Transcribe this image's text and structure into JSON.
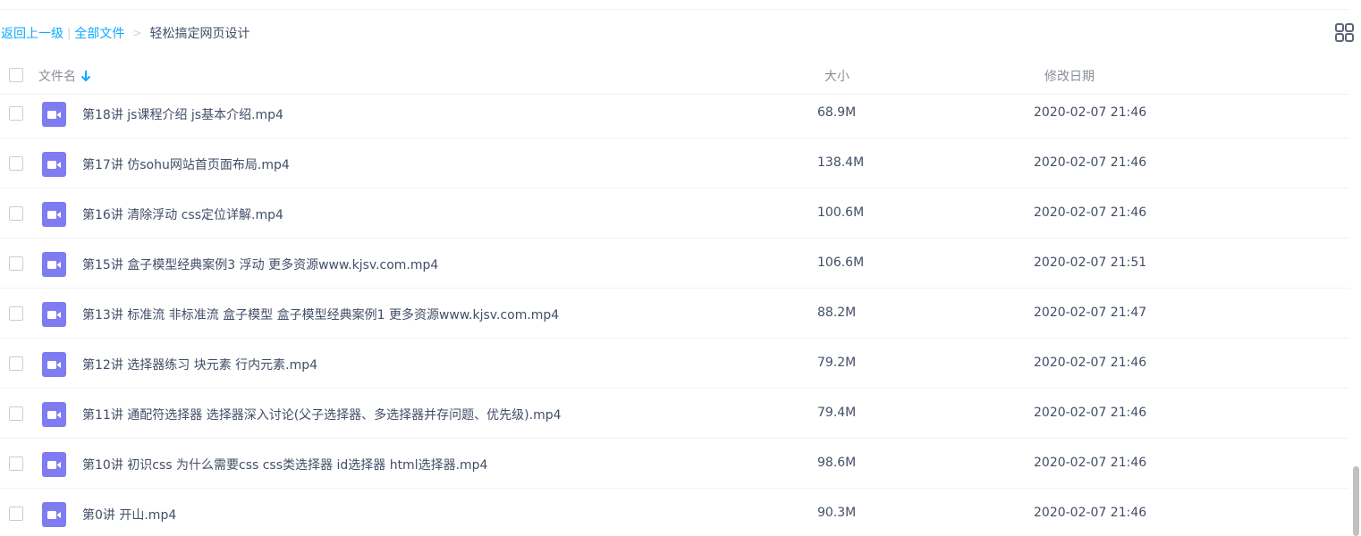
{
  "breadcrumb": {
    "back": "返回上一级",
    "separator": "|",
    "all_files": "全部文件",
    "arrow": ">",
    "current": "轻松搞定网页设计"
  },
  "view_toggle_icon": "grid-view-icon",
  "header": {
    "name": "文件名",
    "size": "大小",
    "date": "修改日期",
    "sort_icon": "arrow-down-icon"
  },
  "file_icon": "video-file-icon",
  "colors": {
    "accent": "#09aaff",
    "video_icon": "#7f7cf1"
  },
  "files": [
    {
      "name": "第18讲 js课程介绍 js基本介绍.mp4",
      "size": "68.9M",
      "date": "2020-02-07 21:46"
    },
    {
      "name": "第17讲 仿sohu网站首页面布局.mp4",
      "size": "138.4M",
      "date": "2020-02-07 21:46"
    },
    {
      "name": "第16讲 清除浮动 css定位详解.mp4",
      "size": "100.6M",
      "date": "2020-02-07 21:46"
    },
    {
      "name": "第15讲 盒子模型经典案例3 浮动 更多资源www.kjsv.com.mp4",
      "size": "106.6M",
      "date": "2020-02-07 21:51"
    },
    {
      "name": "第13讲 标准流 非标准流 盒子模型 盒子模型经典案例1 更多资源www.kjsv.com.mp4",
      "size": "88.2M",
      "date": "2020-02-07 21:47"
    },
    {
      "name": "第12讲 选择器练习 块元素 行内元素.mp4",
      "size": "79.2M",
      "date": "2020-02-07 21:46"
    },
    {
      "name": "第11讲 通配符选择器 选择器深入讨论(父子选择器、多选择器并存问题、优先级).mp4",
      "size": "79.4M",
      "date": "2020-02-07 21:46"
    },
    {
      "name": "第10讲 初识css 为什么需要css css类选择器 id选择器 html选择器.mp4",
      "size": "98.6M",
      "date": "2020-02-07 21:46"
    },
    {
      "name": "第0讲 开山.mp4",
      "size": "90.3M",
      "date": "2020-02-07 21:46"
    }
  ]
}
